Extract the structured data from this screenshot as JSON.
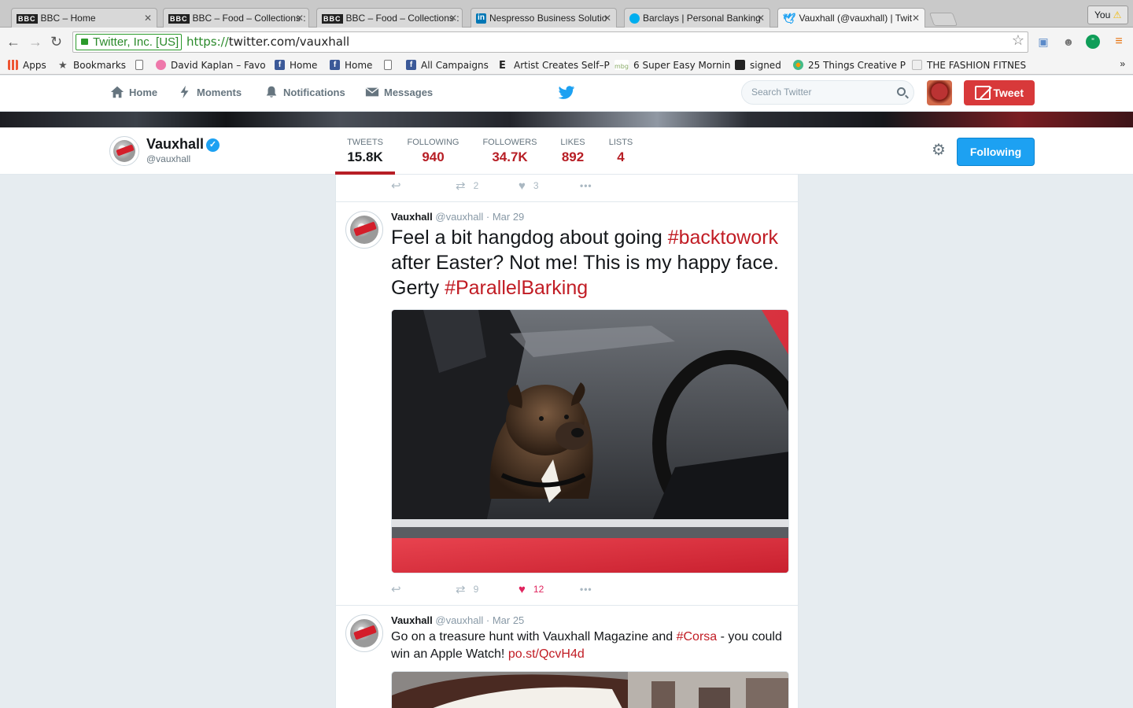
{
  "browser": {
    "tabs": [
      {
        "title": "BBC – Home",
        "favicon": "bbc-icon"
      },
      {
        "title": "BBC – Food – Collections :",
        "favicon": "bbc-icon"
      },
      {
        "title": "BBC – Food – Collections :",
        "favicon": "bbc-icon"
      },
      {
        "title": "Nespresso Business Solutio",
        "favicon": "linkedin-icon"
      },
      {
        "title": "Barclays | Personal Banking",
        "favicon": "barclays-icon"
      },
      {
        "title": "Vauxhall (@vauxhall) | Twit",
        "favicon": "twitter-icon"
      }
    ],
    "profile_label": "You",
    "ev_label": "Twitter, Inc. [US]",
    "url_scheme": "https://",
    "url_rest": "twitter.com/vauxhall",
    "bookmarks": [
      "Apps",
      "Bookmarks",
      "David Kaplan – Favo",
      "Home",
      "Home",
      "",
      "All Campaigns",
      "Artist Creates Self–P",
      "6 Super Easy Mornin",
      "signed",
      "25 Things Creative P",
      "THE FASHION FITNES"
    ]
  },
  "twitter_nav": {
    "home": "Home",
    "moments": "Moments",
    "notifications": "Notifications",
    "messages": "Messages",
    "search_placeholder": "Search Twitter",
    "tweet_button": "Tweet"
  },
  "profile": {
    "name": "Vauxhall",
    "handle": "@vauxhall",
    "stats": [
      {
        "label": "TWEETS",
        "value": "15.8K"
      },
      {
        "label": "FOLLOWING",
        "value": "940"
      },
      {
        "label": "FOLLOWERS",
        "value": "34.7K"
      },
      {
        "label": "LIKES",
        "value": "892"
      },
      {
        "label": "LISTS",
        "value": "4"
      }
    ],
    "following_button": "Following"
  },
  "tweets": [
    {
      "retweets": "2",
      "likes": "3"
    },
    {
      "author": "Vauxhall",
      "meta": "@vauxhall · Mar 29",
      "text_1": "Feel a bit hangdog about going ",
      "tag_1": "#backtowork",
      "text_2": " after Easter? Not me! This is my happy face. Gerty  ",
      "tag_2": "#ParallelBarking",
      "retweets": "9",
      "likes": "12"
    },
    {
      "author": "Vauxhall",
      "meta": "@vauxhall · Mar 25",
      "text_1": "Go on a treasure hunt with Vauxhall Magazine and ",
      "tag_1": "#Corsa",
      "text_2": " - you could win an Apple Watch! ",
      "link": "po.st/QcvH4d"
    }
  ],
  "colors": {
    "accent": "#c11c24",
    "twitter_blue": "#1da1f2",
    "tweet_button": "#d8393a"
  }
}
